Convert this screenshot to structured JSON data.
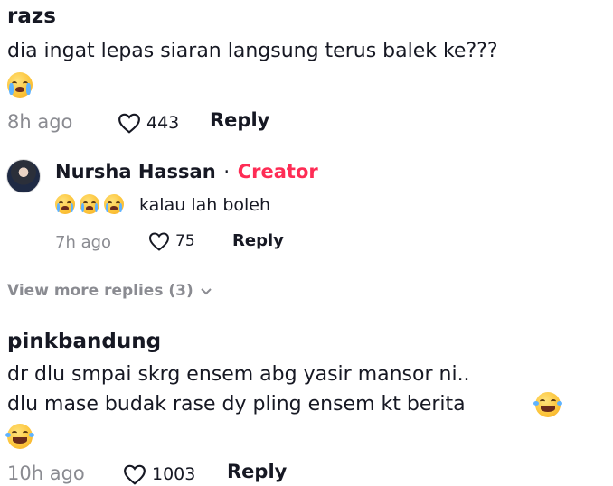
{
  "comments": [
    {
      "username": "razs",
      "text": "dia ingat lepas siaran langsung terus balek ke???",
      "emoji_line": "crying-face",
      "time": "8h ago",
      "likes": "443",
      "reply_label": "Reply"
    },
    {
      "username": "pinkbandung",
      "text_line1": "dr dlu smpai skrg ensem abg yasir mansor ni..",
      "text_line2": "dlu mase budak rase dy pling ensem kt berita",
      "emoji": "laughing-with-tears",
      "time": "10h ago",
      "likes": "1003",
      "reply_label": "Reply"
    }
  ],
  "reply": {
    "username": "Nursha Hassan",
    "separator": "·",
    "badge": "Creator",
    "emojis": "crying-face x3",
    "text": "kalau lah boleh",
    "time": "7h ago",
    "likes": "75",
    "reply_label": "Reply"
  },
  "view_more": "View more replies (3)",
  "colors": {
    "creator_badge": "#fe2c55",
    "meta_gray": "#8a8b91",
    "text": "#161823"
  }
}
